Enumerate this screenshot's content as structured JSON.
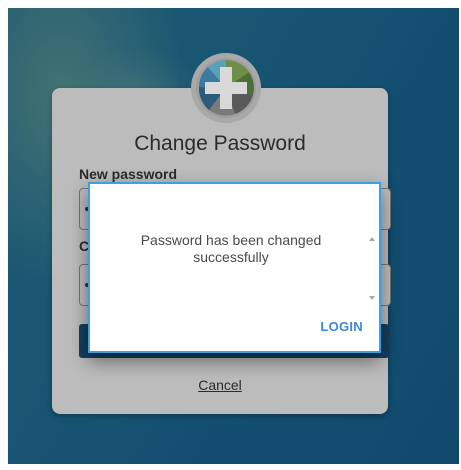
{
  "form": {
    "title": "Change Password",
    "new_password_label": "New password",
    "confirm_label_partial": "C",
    "cancel_label": "Cancel"
  },
  "dialog": {
    "message": "Password has been changed successfully",
    "login_label": "LOGIN"
  },
  "colors": {
    "background": "#1f6a8c",
    "card": "#bcbcbc",
    "submit_button": "#153f61",
    "dialog_border": "#3aa0e0",
    "login_text": "#3f86d6"
  },
  "icons": {
    "logo": "cross-wheel-logo-icon",
    "scroll_up": "scroll-up-arrow-icon",
    "scroll_down": "scroll-down-arrow-icon"
  }
}
